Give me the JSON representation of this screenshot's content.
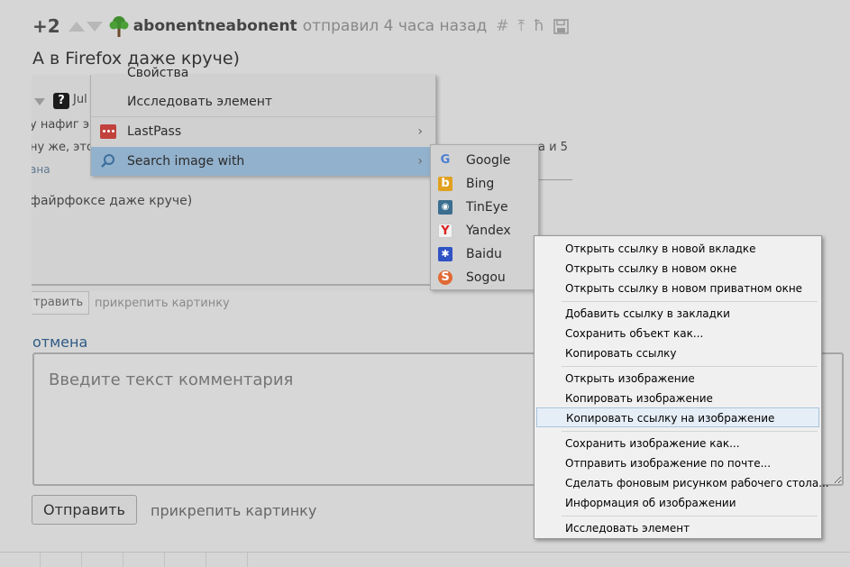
{
  "comment": {
    "score": "+2",
    "username": "abonentneabonent",
    "posted": "отправил 4 часа назад",
    "icons": {
      "hash": "#",
      "up": "⤒",
      "reply": "ħ",
      "save": "save-icon"
    },
    "text": "А в Firefox даже круче)"
  },
  "embedded": {
    "user_fragment": "Jul",
    "line1": "у нафиг э",
    "line2": "ну же, это",
    "line2_right": "а и 5",
    "link": "ана",
    "reply_text": "файрфоксе даже круче)",
    "send_label": "травить",
    "attach_label": "прикрепить картинку",
    "menu": {
      "properties": "Свойства",
      "inspect": "Исследовать элемент",
      "lastpass": "LastPass",
      "search_image": "Search image with",
      "arrow": "›"
    },
    "engines": [
      "Google",
      "Bing",
      "TinEye",
      "Yandex",
      "Baidu",
      "Sogou"
    ]
  },
  "form": {
    "cancel": "отмена",
    "placeholder": "Введите текст комментария",
    "send": "Отправить",
    "attach": "прикрепить картинку"
  },
  "context_menu": {
    "group1": [
      "Открыть ссылку в новой вкладке",
      "Открыть ссылку в новом окне",
      "Открыть ссылку в новом приватном окне"
    ],
    "group2": [
      "Добавить ссылку в закладки",
      "Сохранить объект как...",
      "Копировать ссылку"
    ],
    "group3": [
      "Открыть изображение",
      "Копировать изображение",
      "Копировать ссылку на изображение"
    ],
    "group4": [
      "Сохранить изображение как...",
      "Отправить изображение по почте...",
      "Сделать фоновым рисунком рабочего стола...",
      "Информация об изображении"
    ],
    "group5": [
      "Исследовать элемент"
    ]
  },
  "colors": {
    "link": "#2f5b85",
    "highlight": "#e5eef7",
    "inner_highlight": "#92b1cc",
    "lastpass": "#c1413c"
  }
}
